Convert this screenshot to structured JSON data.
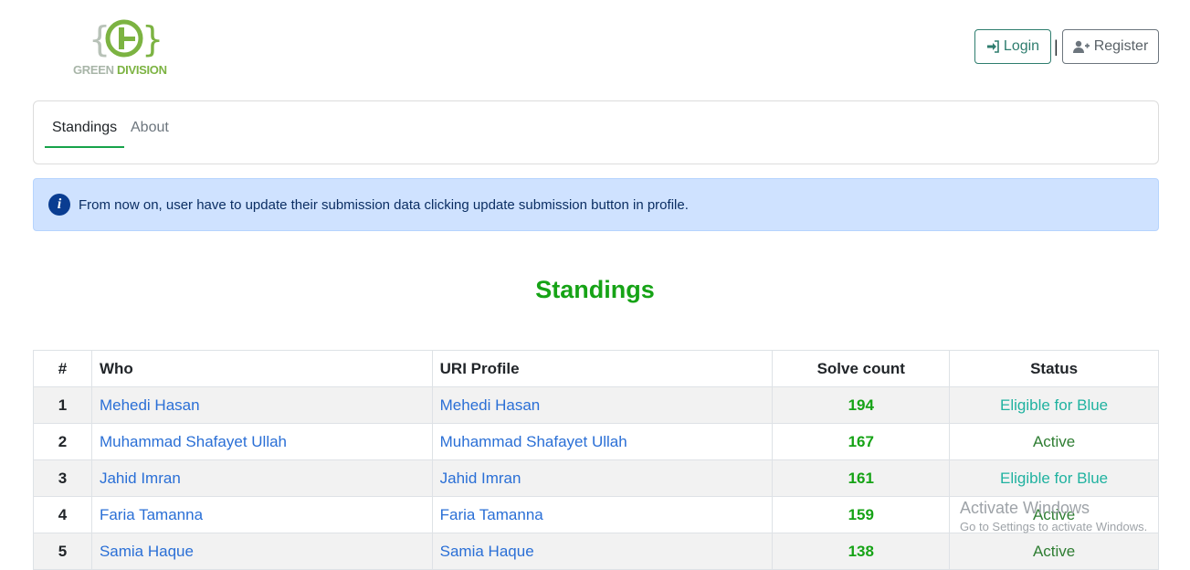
{
  "logo": {
    "text_1": "GREEN",
    "text_2": "DIVISION",
    "colors": {
      "gray": "#a8b5a8",
      "green": "#7cb342"
    }
  },
  "header": {
    "login_label": "Login",
    "login_icon": "sign-in-icon",
    "separator": "|",
    "register_label": "Register",
    "register_icon": "user-plus-icon"
  },
  "nav": {
    "tabs": [
      {
        "label": "Standings",
        "active": true
      },
      {
        "label": "About",
        "active": false
      }
    ]
  },
  "alert": {
    "icon": "info-icon",
    "text": "From now on, user have to update their submission data clicking update submission button in profile."
  },
  "page": {
    "heading": "Standings"
  },
  "table": {
    "headers": [
      "#",
      "Who",
      "URI Profile",
      "Solve count",
      "Status"
    ],
    "rows": [
      {
        "rank": "1",
        "who": "Mehedi Hasan",
        "uri": "Mehedi Hasan",
        "solve": "194",
        "status": "Eligible for Blue"
      },
      {
        "rank": "2",
        "who": "Muhammad Shafayet Ullah",
        "uri": "Muhammad Shafayet Ullah",
        "solve": "167",
        "status": "Active"
      },
      {
        "rank": "3",
        "who": "Jahid Imran",
        "uri": "Jahid Imran",
        "solve": "161",
        "status": "Eligible for Blue"
      },
      {
        "rank": "4",
        "who": "Faria Tamanna",
        "uri": "Faria Tamanna",
        "solve": "159",
        "status": "Active"
      },
      {
        "rank": "5",
        "who": "Samia Haque",
        "uri": "Samia Haque",
        "solve": "138",
        "status": "Active"
      }
    ]
  },
  "watermark": {
    "title": "Activate Windows",
    "subtitle": "Go to Settings to activate Windows."
  },
  "colors": {
    "accent_green": "#16a316",
    "link_blue": "#2a6fd6",
    "eligible_teal": "#20b2a0",
    "active_green": "#2e7d32",
    "alert_bg": "#cfe2ff"
  }
}
